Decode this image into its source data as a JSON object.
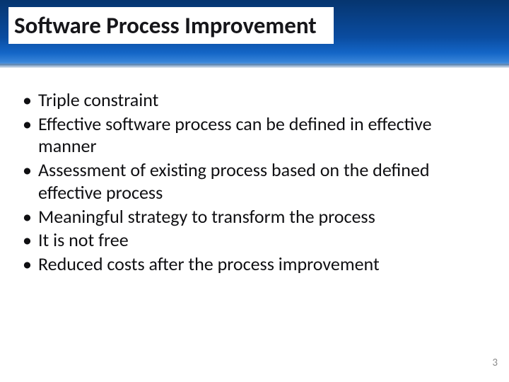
{
  "slide": {
    "title": "Software Process Improvement",
    "bullets": [
      "Triple constraint",
      "Effective software process can be defined in effective manner",
      "Assessment of existing process based on the defined effective process",
      "Meaningful strategy to transform the process",
      "It is not free",
      "Reduced costs after the process improvement"
    ],
    "page_number": "3"
  }
}
